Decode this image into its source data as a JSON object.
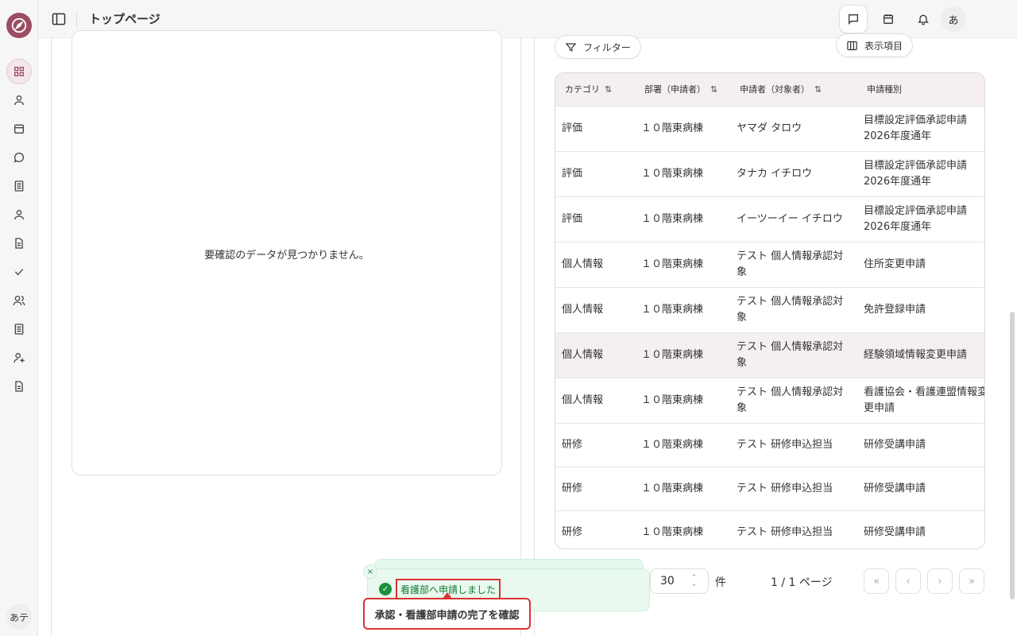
{
  "app": {
    "logo_icon": "compass-icon",
    "accent": "#9c4d63"
  },
  "header": {
    "title": "トップページ",
    "avatar": "あ",
    "icons": [
      "message-square-icon",
      "calendar-icon",
      "bell-icon",
      "chat-bubble-icon"
    ]
  },
  "sidebar": {
    "items": [
      "dashboard-grid-icon",
      "user-icon",
      "calendar-icon",
      "chat-bubble-icon",
      "document-list-icon",
      "user-icon",
      "file-text-icon",
      "check-icon",
      "users-icon",
      "document-list-icon",
      "user-plus-icon",
      "file-text-icon"
    ],
    "user_initials": "あテ"
  },
  "left_panel": {
    "empty_message": "要確認のデータが見つかりません。"
  },
  "right_panel": {
    "filter_label": "フィルター",
    "columns_label": "表示項目",
    "table": {
      "headers": [
        "カテゴリ",
        "部署（申請者）",
        "申請者（対象者）",
        "申請種別"
      ],
      "sort_glyph": "⇅",
      "rows": [
        [
          "評価",
          "１０階東病棟",
          "ヤマダ タロウ",
          "目標設定評価承認申請 2026年度通年"
        ],
        [
          "評価",
          "１０階東病棟",
          "タナカ イチロウ",
          "目標設定評価承認申請 2026年度通年"
        ],
        [
          "評価",
          "１０階東病棟",
          "イーツーイー イチロウ",
          "目標設定評価承認申請 2026年度通年"
        ],
        [
          "個人情報",
          "１０階東病棟",
          "テスト 個人情報承認対象",
          "住所変更申請"
        ],
        [
          "個人情報",
          "１０階東病棟",
          "テスト 個人情報承認対象",
          "免許登録申請"
        ],
        [
          "個人情報",
          "１０階東病棟",
          "テスト 個人情報承認対象",
          "経験領域情報変更申請"
        ],
        [
          "個人情報",
          "１０階東病棟",
          "テスト 個人情報承認対象",
          "看護協会・看護連盟情報変更申請"
        ],
        [
          "研修",
          "１０階東病棟",
          "テスト 研修申込担当",
          "研修受講申請"
        ],
        [
          "研修",
          "１０階東病棟",
          "テスト 研修申込担当",
          "研修受講申請"
        ],
        [
          "研修",
          "１０階東病棟",
          "テスト 研修申込担当",
          "研修受講申請"
        ]
      ]
    },
    "pagination": {
      "per_page": "30",
      "unit": "件",
      "page_info": "1 / 1 ページ"
    }
  },
  "toast": {
    "message": "看護部へ申請しました",
    "close": "×",
    "status_color": "#1a8f3c"
  },
  "tooltip": {
    "text": "承認・看護部申請の完了を確認"
  }
}
